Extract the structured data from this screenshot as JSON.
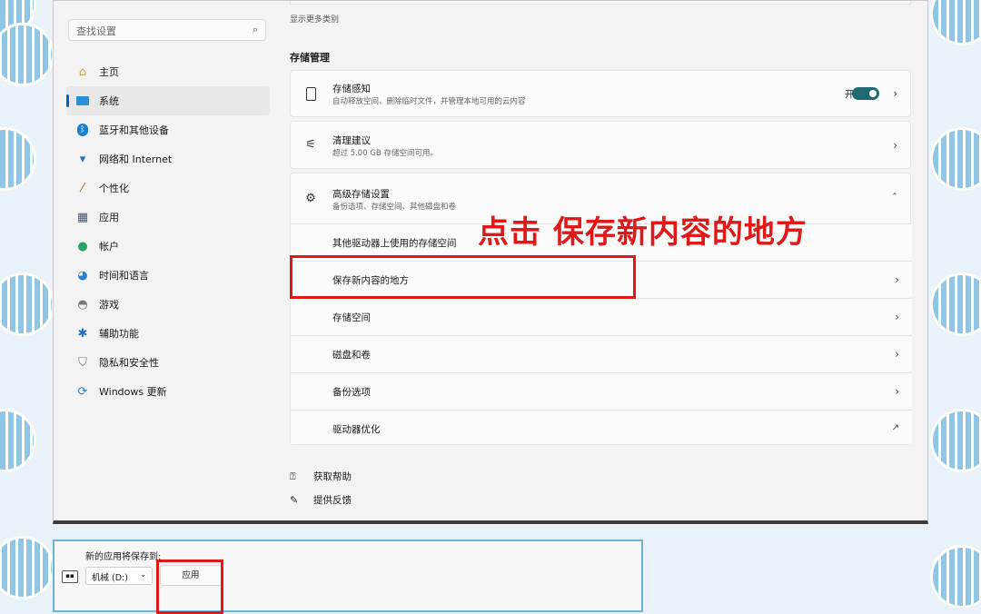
{
  "search": {
    "placeholder": "查找设置"
  },
  "nav": [
    {
      "label": "主页",
      "icon": "home-icon"
    },
    {
      "label": "系统",
      "icon": "system-icon",
      "active": true
    },
    {
      "label": "蓝牙和其他设备",
      "icon": "bluetooth-icon"
    },
    {
      "label": "网络和 Internet",
      "icon": "wifi-icon"
    },
    {
      "label": "个性化",
      "icon": "brush-icon"
    },
    {
      "label": "应用",
      "icon": "apps-icon"
    },
    {
      "label": "帐户",
      "icon": "person-icon"
    },
    {
      "label": "时间和语言",
      "icon": "globe-clock-icon"
    },
    {
      "label": "游戏",
      "icon": "gamepad-icon"
    },
    {
      "label": "辅助功能",
      "icon": "accessibility-icon"
    },
    {
      "label": "隐私和安全性",
      "icon": "shield-icon"
    },
    {
      "label": "Windows 更新",
      "icon": "sync-icon"
    }
  ],
  "main": {
    "show_more": "显示更多类别",
    "section_title": "存储管理",
    "storage_sense": {
      "title": "存储感知",
      "subtitle": "自动释放空间、删除临时文件，并管理本地可用的云内容",
      "toggle_label": "开",
      "toggle_on": true
    },
    "cleanup": {
      "title": "清理建议",
      "subtitle": "超过 5.00 GB 存储空间可用。"
    },
    "advanced": {
      "title": "高级存储设置",
      "subtitle": "备份选项、存储空间、其他磁盘和卷",
      "items": [
        {
          "label": "其他驱动器上使用的存储空间"
        },
        {
          "label": "保存新内容的地方"
        },
        {
          "label": "存储空间"
        },
        {
          "label": "磁盘和卷"
        },
        {
          "label": "备份选项"
        },
        {
          "label": "驱动器优化"
        }
      ]
    },
    "help": "获取帮助",
    "feedback": "提供反馈"
  },
  "annotation": "点击 保存新内容的地方",
  "dialog": {
    "caption": "新的应用将保存到:",
    "drive": "机械 (D:)",
    "apply": "应用"
  },
  "colors": {
    "annotation": "#e01818",
    "toggle": "#1f6b74",
    "accent": "#0067c0"
  }
}
